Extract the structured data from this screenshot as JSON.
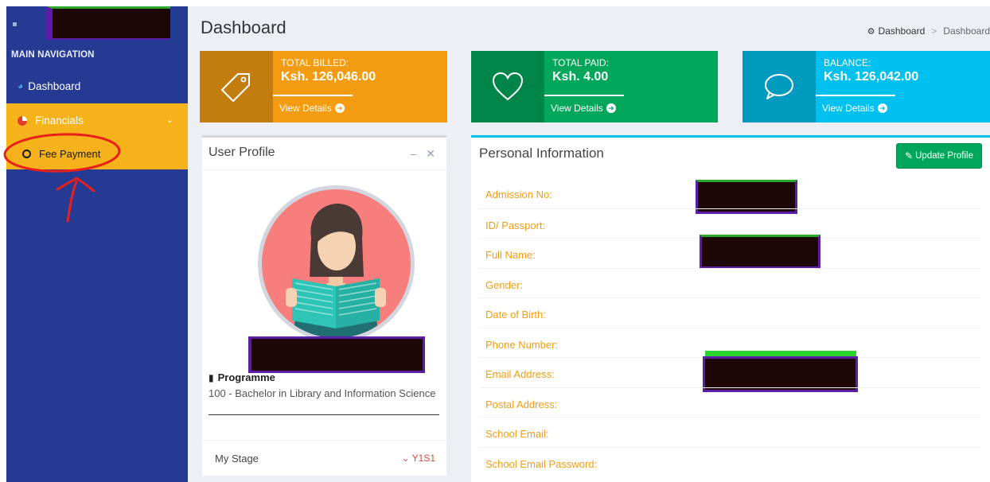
{
  "sidebar": {
    "header": "MAIN NAVIGATION",
    "items": [
      {
        "label": "Dashboard"
      },
      {
        "label": "Financials"
      },
      {
        "label": "Fee Payment"
      }
    ]
  },
  "header": {
    "title": "Dashboard",
    "breadcrumb": [
      "Dashboard",
      "Dashboard"
    ]
  },
  "stats": [
    {
      "label": "TOTAL BILLED:",
      "value": "Ksh. 126,046.00",
      "link": "View Details",
      "icon": "tag-icon",
      "color": "#f39c12"
    },
    {
      "label": "TOTAL PAID:",
      "value": "Ksh. 4.00",
      "link": "View Details",
      "icon": "heart-icon",
      "color": "#00a65a"
    },
    {
      "label": "BALANCE:",
      "value": "Ksh. 126,042.00",
      "link": "View Details",
      "icon": "chat-bubble-icon",
      "color": "#00c0ef"
    }
  ],
  "profile": {
    "title": "User Profile",
    "programme_label": "Programme",
    "programme_value": "100 - Bachelor in Library and Information Science",
    "stage_label": "My Stage",
    "stage_value": "Y1S1"
  },
  "personal": {
    "title": "Personal Information",
    "update_button": "Update Profile",
    "fields": [
      {
        "label": "Admission No:"
      },
      {
        "label": "ID/ Passport:"
      },
      {
        "label": "Full Name:"
      },
      {
        "label": "Gender:"
      },
      {
        "label": "Date of Birth:"
      },
      {
        "label": "Phone Number:"
      },
      {
        "label": "Email Address:"
      },
      {
        "label": "Postal Address:"
      },
      {
        "label": "School Email:"
      },
      {
        "label": "School Email Password:"
      }
    ]
  }
}
